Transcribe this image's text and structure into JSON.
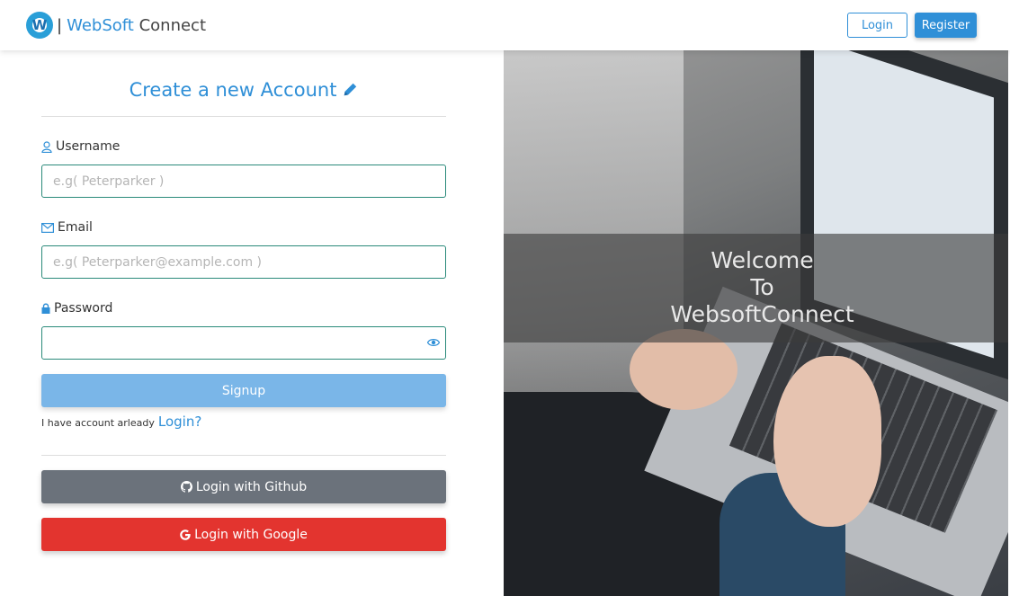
{
  "navbar": {
    "logo_letter": "W",
    "brand_separator": "|",
    "brand_accent": "WebSoft",
    "brand_rest": "Connect",
    "login_label": "Login",
    "register_label": "Register"
  },
  "form": {
    "title": "Create a new Account",
    "username": {
      "label": "Username",
      "placeholder": "e.g( Peterparker )",
      "value": ""
    },
    "email": {
      "label": "Email",
      "placeholder": "e.g( Peterparker@example.com )",
      "value": ""
    },
    "password": {
      "label": "Password",
      "placeholder": "",
      "value": ""
    },
    "signup_label": "Signup",
    "have_account_text": "I have account arleady",
    "login_link": "Login?",
    "github_label": "Login with Github",
    "google_label": "Login with Google"
  },
  "hero": {
    "line1": "Welcome",
    "line2": "To",
    "line3": "WebsoftConnect"
  },
  "colors": {
    "primary": "#2f8fd7",
    "signup": "#7ab6e8",
    "github": "#6b727b",
    "google": "#e3342f",
    "input_border": "#2a8a7a"
  },
  "icons": [
    "user-icon",
    "envelope-icon",
    "lock-icon",
    "eye-icon",
    "pencil-icon",
    "github-icon",
    "google-icon"
  ]
}
